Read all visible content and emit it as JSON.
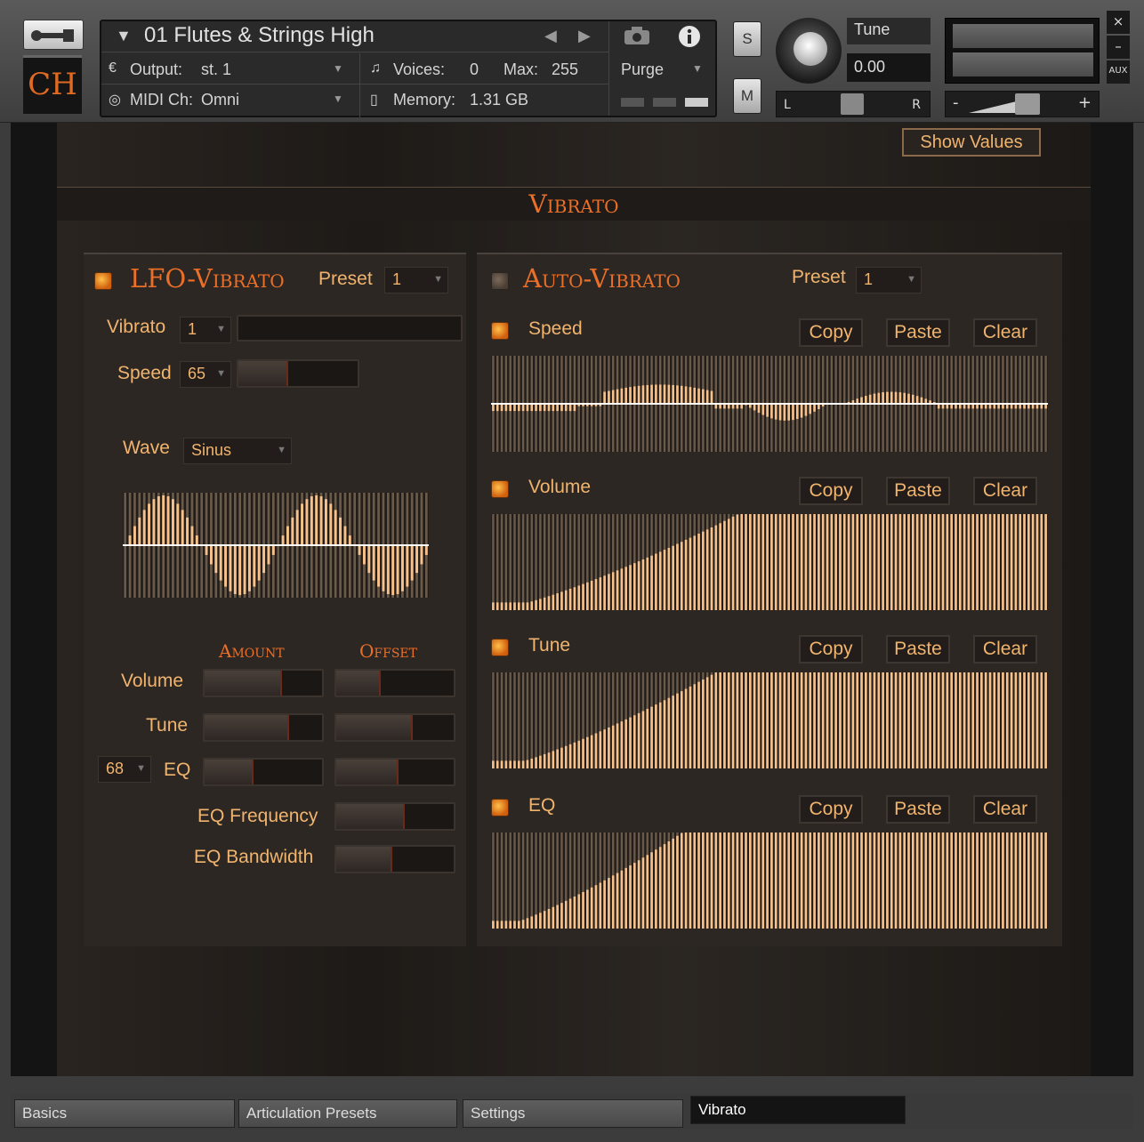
{
  "header": {
    "logo_text": "CH",
    "instrument_name": "01 Flutes & Strings High",
    "output_label": "Output:",
    "output_value": "st. 1",
    "voices_label": "Voices:",
    "voices_value": "0",
    "max_label": "Max:",
    "max_value": "255",
    "purge_label": "Purge",
    "midi_label": "MIDI Ch:",
    "midi_value": "Omni",
    "memory_label": "Memory:",
    "memory_value": "1.31 GB",
    "solo_label": "S",
    "mute_label": "M",
    "tune_label": "Tune",
    "tune_value": "0.00",
    "pan_left": "L",
    "pan_right": "R",
    "vol_minus": "-",
    "vol_plus": "+",
    "close_label": "×",
    "minimize_label": "–",
    "aux_label": "AUX"
  },
  "main": {
    "show_values_label": "Show Values",
    "title": "Vibrato"
  },
  "lfo": {
    "title": "LFO-Vibrato",
    "preset_label": "Preset",
    "preset_value": "1",
    "vibrato_label": "Vibrato",
    "vibrato_value": "1",
    "vibrato_level": 0.0,
    "speed_label": "Speed",
    "speed_value": "65",
    "speed_level": 0.42,
    "wave_label": "Wave",
    "wave_value": "Sinus",
    "amount_header": "Amount",
    "offset_header": "Offset",
    "eq_num_value": "68",
    "rows": [
      {
        "label": "Volume",
        "amount": 0.66,
        "offset": 0.38
      },
      {
        "label": "Tune",
        "amount": 0.72,
        "offset": 0.65
      },
      {
        "label": "EQ",
        "amount": 0.42,
        "offset": 0.53
      }
    ],
    "eq_frequency_label": "EQ Frequency",
    "eq_frequency_level": 0.58,
    "eq_bandwidth_label": "EQ Bandwidth",
    "eq_bandwidth_level": 0.48
  },
  "auto": {
    "title": "Auto-Vibrato",
    "preset_label": "Preset",
    "preset_value": "1",
    "copy_label": "Copy",
    "paste_label": "Paste",
    "clear_label": "Clear",
    "sections": [
      {
        "label": "Speed",
        "type": "bipolar"
      },
      {
        "label": "Volume",
        "type": "ramp"
      },
      {
        "label": "Tune",
        "type": "ramp"
      },
      {
        "label": "EQ",
        "type": "ramp"
      }
    ]
  },
  "tabs": [
    "Basics",
    "Articulation Presets",
    "Settings",
    "Vibrato"
  ],
  "active_tab": "Vibrato"
}
